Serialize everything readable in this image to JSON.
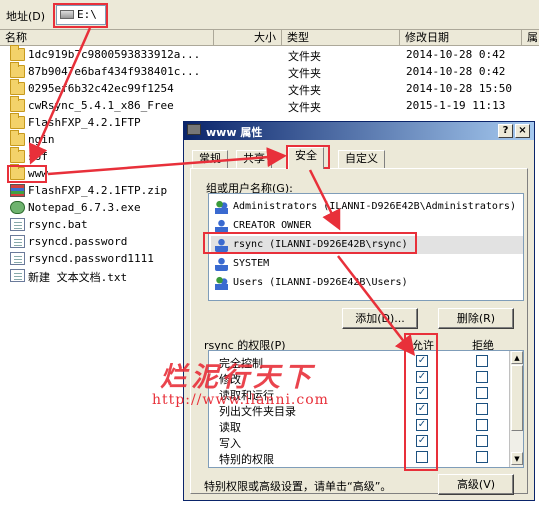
{
  "address_bar": {
    "label": "地址(D)",
    "path": "E:\\"
  },
  "columns": [
    {
      "key": "name",
      "label": "名称"
    },
    {
      "key": "size",
      "label": "大小"
    },
    {
      "key": "type",
      "label": "类型"
    },
    {
      "key": "modified",
      "label": "修改日期"
    },
    {
      "key": "attr",
      "label": "属"
    }
  ],
  "files": [
    {
      "name": "1dc919b7c9800593833912a...",
      "type": "文件夹",
      "date": "2014-10-28 0:42",
      "icon": "folder-icon"
    },
    {
      "name": "87b9047e6baf434f938401c...",
      "type": "文件夹",
      "date": "2014-10-28 0:42",
      "icon": "folder-icon"
    },
    {
      "name": "0295ef6b32c42ec99f1254",
      "type": "文件夹",
      "date": "2014-10-28 15:50",
      "icon": "folder-icon"
    },
    {
      "name": "cwRsync_5.4.1_x86_Free",
      "type": "文件夹",
      "date": "2015-1-19 11:13",
      "icon": "folder-icon"
    },
    {
      "name": "FlashFXP_4.2.1FTP",
      "type": "",
      "date": "",
      "icon": "folder-icon"
    },
    {
      "name": "ngin",
      "type": "",
      "date": "",
      "icon": "folder-icon"
    },
    {
      "name": "sof",
      "type": "",
      "date": "",
      "icon": "folder-icon"
    },
    {
      "name": "www",
      "type": "",
      "date": "",
      "icon": "folder-icon"
    },
    {
      "name": "FlashFXP_4.2.1FTP.zip",
      "type": "",
      "date": "",
      "icon": "zip-icon"
    },
    {
      "name": "Notepad_6.7.3.exe",
      "type": "",
      "date": "",
      "icon": "exe-icon"
    },
    {
      "name": "rsync.bat",
      "type": "",
      "date": "",
      "icon": "text-file-icon"
    },
    {
      "name": "rsyncd.password",
      "type": "",
      "date": "",
      "icon": "text-file-icon"
    },
    {
      "name": "rsyncd.password1111",
      "type": "",
      "date": "",
      "icon": "text-file-icon"
    },
    {
      "name": "新建 文本文档.txt",
      "type": "",
      "date": "",
      "icon": "text-file-icon"
    }
  ],
  "dialog": {
    "title": "www 属性",
    "tabs": [
      "常规",
      "共享",
      "安全",
      "自定义"
    ],
    "active_tab": "安全",
    "group_label": "组或用户名称(G):",
    "users": [
      {
        "name": "Administrators (ILANNI-D926E42B\\Administrators)",
        "icon": "group-icon"
      },
      {
        "name": "CREATOR OWNER",
        "icon": "user-icon"
      },
      {
        "name": "rsync (ILANNI-D926E42B\\rsync)",
        "icon": "user-icon"
      },
      {
        "name": "SYSTEM",
        "icon": "user-icon"
      },
      {
        "name": "Users (ILANNI-D926E42B\\Users)",
        "icon": "group-icon"
      }
    ],
    "add_button": "添加(D)...",
    "remove_button": "删除(R)",
    "perm_label": "rsync 的权限(P)",
    "allow_header": "允许",
    "deny_header": "拒绝",
    "permissions": [
      {
        "name": "完全控制",
        "allow": true,
        "deny": false
      },
      {
        "name": "修改",
        "allow": true,
        "deny": false
      },
      {
        "name": "读取和运行",
        "allow": true,
        "deny": false
      },
      {
        "name": "列出文件夹目录",
        "allow": true,
        "deny": false
      },
      {
        "name": "读取",
        "allow": true,
        "deny": false
      },
      {
        "name": "写入",
        "allow": true,
        "deny": false
      },
      {
        "name": "特别的权限",
        "allow": false,
        "deny": false
      }
    ],
    "hint": "特别权限或高级设置，请单击“高级”。",
    "advanced_button": "高级(V)",
    "help_button": "?",
    "close_button": "×"
  },
  "watermark": {
    "text": "烂泥行天下",
    "url": "http://www.ilanni.com"
  },
  "highlight_color": "#e8303a"
}
